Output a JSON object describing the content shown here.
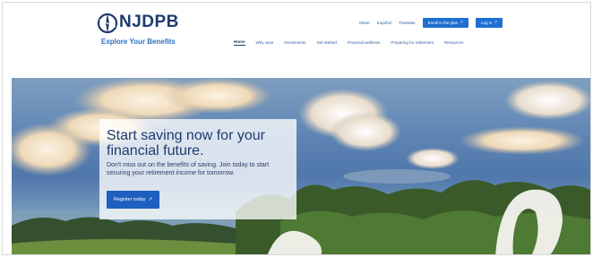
{
  "brand": {
    "logo_text": "NJDPB",
    "tagline": "Explore Your Benefits"
  },
  "utility_nav": {
    "links": [
      "Share",
      "Español",
      "Translate"
    ],
    "enroll_label": "Enroll in the plan",
    "login_label": "Log in"
  },
  "main_nav": {
    "items": [
      "Home",
      "Why save",
      "Investments",
      "Get started",
      "Financial wellness",
      "Preparing for retirement",
      "Resources"
    ]
  },
  "hero": {
    "title": "Start saving now for your financial future.",
    "body": "Don't miss out on the benefits of saving. Join today to start securing your retirement income for tomorrow.",
    "cta_label": "Register today"
  },
  "colors": {
    "primary": "#1e3a6e",
    "accent": "#1f6fd1",
    "link": "#2f5f9a"
  }
}
